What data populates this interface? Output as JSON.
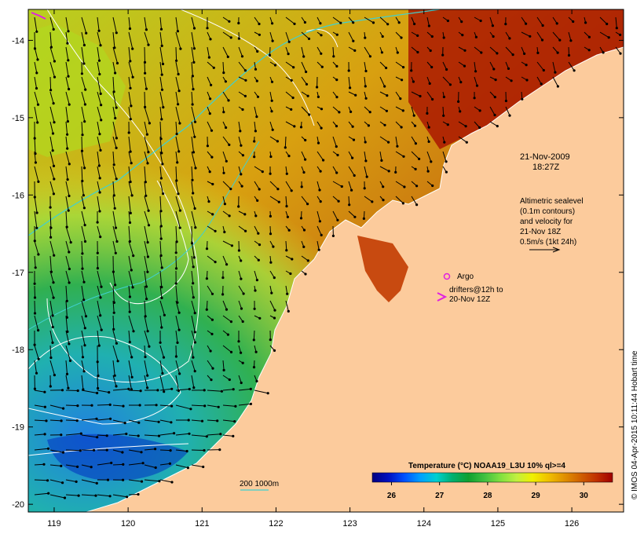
{
  "map": {
    "lon_ticks": [
      "119",
      "120",
      "121",
      "122",
      "123",
      "124",
      "125",
      "126"
    ],
    "lat_ticks": [
      "-14",
      "-15",
      "-16",
      "-17",
      "-18",
      "-19",
      "-20"
    ],
    "lon_range": [
      118.65,
      126.7
    ],
    "lat_range": [
      -13.6,
      -20.1
    ],
    "land_color": "#fccb9c"
  },
  "annotations": {
    "date": "21-Nov-2009",
    "time": "18:27Z",
    "altimetry_lines": [
      "Altimetric sealevel",
      "(0.1m contours)",
      "and velocity for",
      "21-Nov 18Z",
      "0.5m/s (1kt 24h)"
    ],
    "argo_label": "Argo",
    "drifters_line1": "drifters@12h to",
    "drifters_line2": "20-Nov 12Z",
    "depth_legend": "200  1000m",
    "argo_color": "#e020e0",
    "isobath_200_color": "#40d0d0"
  },
  "colorbar": {
    "title": "Temperature (°C) NOAA19_L3U 10% ql>=4",
    "ticks": [
      "26",
      "27",
      "28",
      "29",
      "30"
    ],
    "colors": [
      "#000080",
      "#0010c0",
      "#0050ff",
      "#00a0ff",
      "#00d0d0",
      "#00b070",
      "#10a030",
      "#40c040",
      "#80e040",
      "#c0f040",
      "#f0f000",
      "#f0c000",
      "#e09000",
      "#d06000",
      "#c03000",
      "#a00000"
    ]
  },
  "credit": "© IMOS 04-Apr-2015 10:11:44 Hobart time"
}
